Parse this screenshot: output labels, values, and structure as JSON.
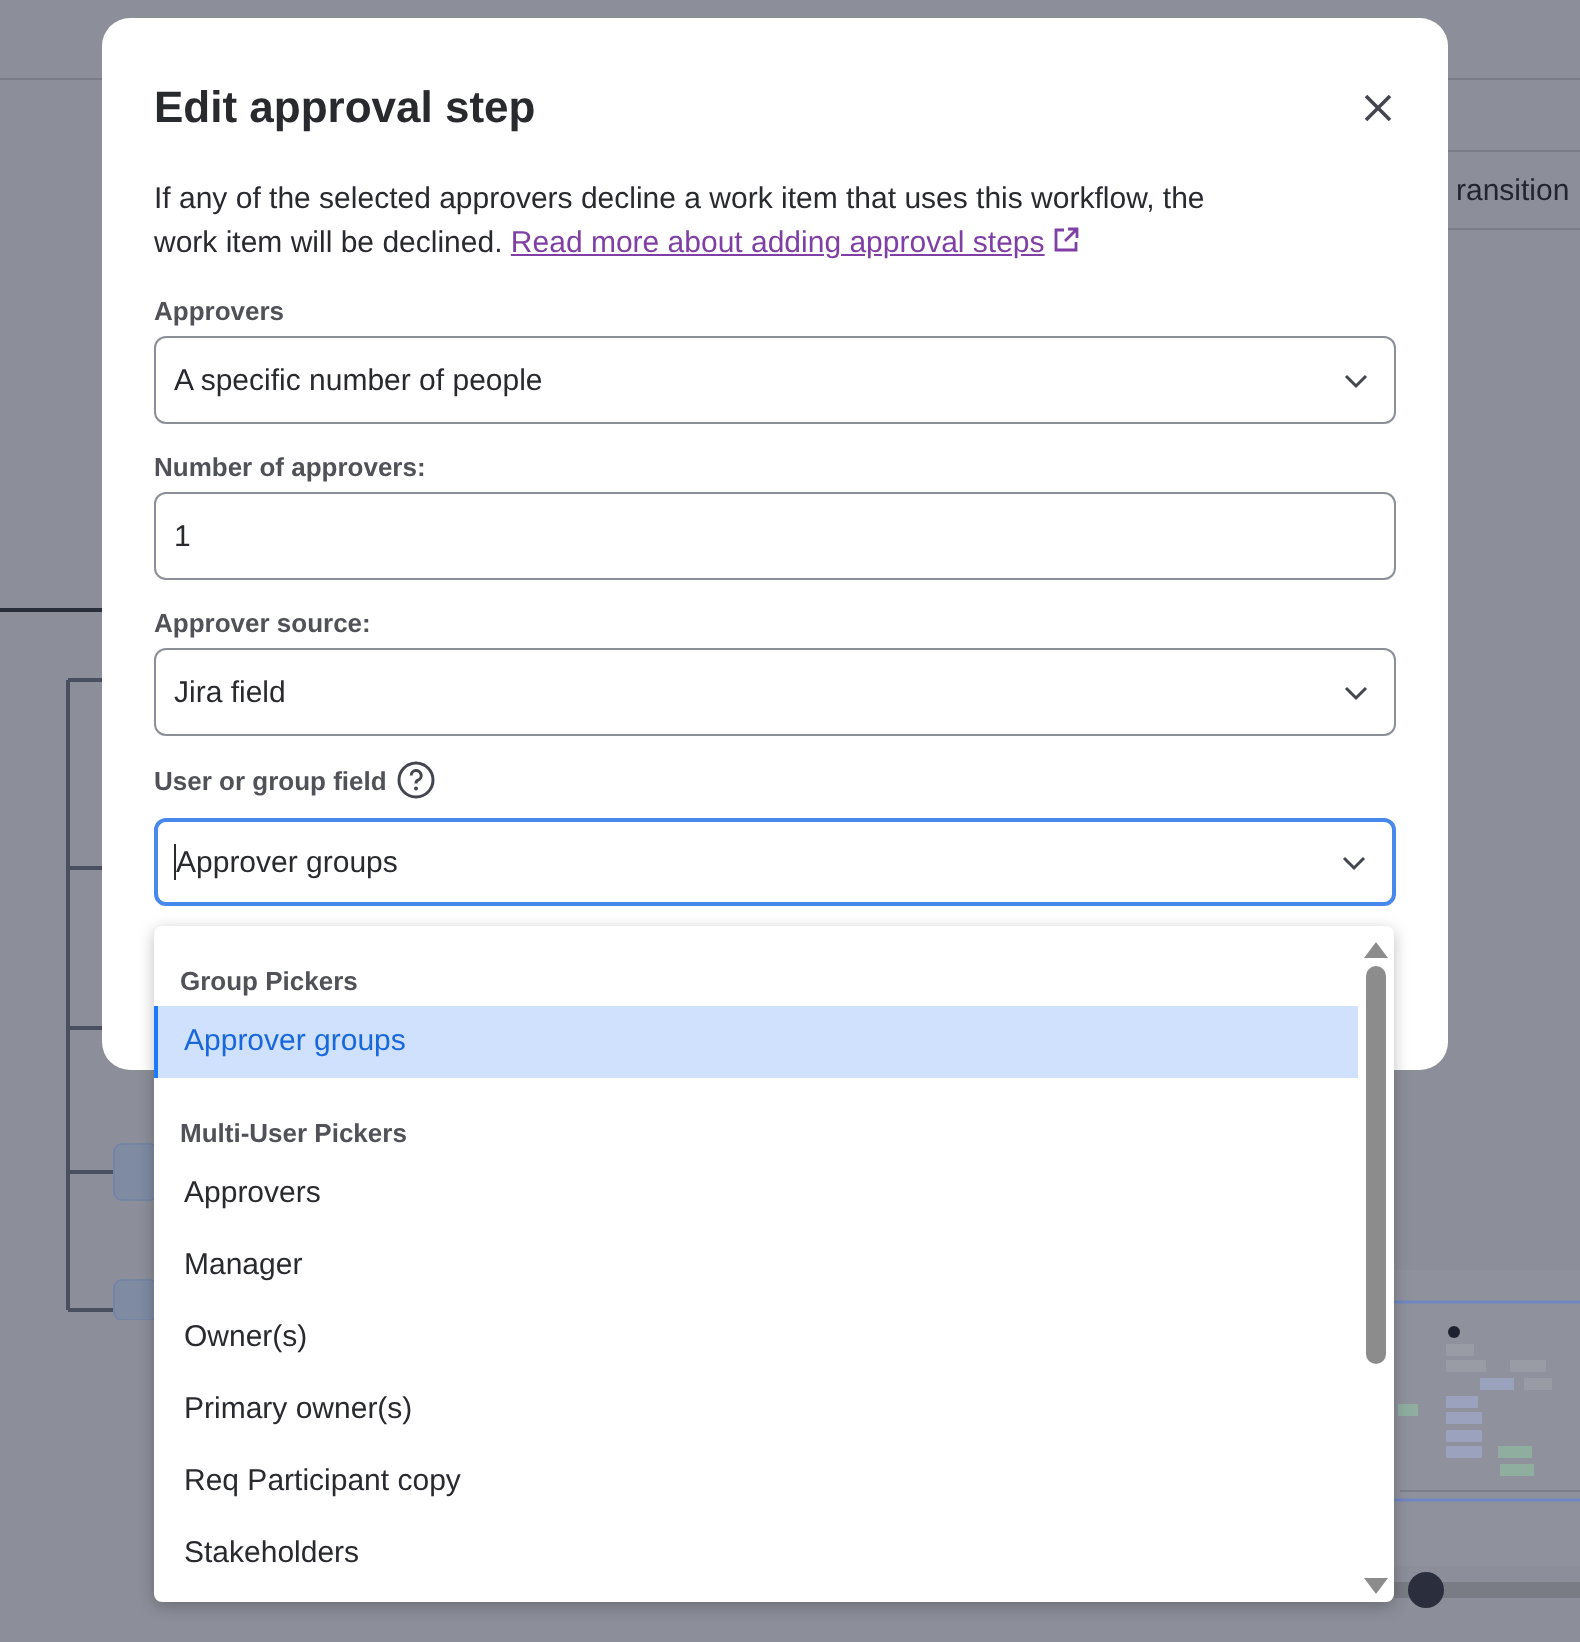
{
  "side_panel": {
    "tab": "ransition"
  },
  "dialog": {
    "title": "Edit approval step",
    "description": "If any of the selected approvers decline a work item that uses this workflow, the work item will be declined.",
    "link": "Read more about adding approval steps",
    "fields": [
      {
        "label": "Approvers",
        "kind": "select",
        "value": "A specific number of people",
        "help": false,
        "focused": false
      },
      {
        "label": "Number of approvers:",
        "kind": "text",
        "value": "1",
        "help": false,
        "focused": false
      },
      {
        "label": "Approver source:",
        "kind": "select",
        "value": "Jira field",
        "help": false,
        "focused": false
      },
      {
        "label": "User or group field",
        "kind": "select",
        "value": "Approver groups",
        "help": true,
        "focused": true
      }
    ]
  },
  "dropdown": {
    "groups": [
      {
        "heading": "Group Pickers",
        "options": [
          {
            "label": "Approver groups",
            "selected": true
          }
        ]
      },
      {
        "heading": "Multi-User Pickers",
        "options": [
          {
            "label": "Approvers",
            "selected": false
          },
          {
            "label": "Manager",
            "selected": false
          },
          {
            "label": "Owner(s)",
            "selected": false
          },
          {
            "label": "Primary owner(s)",
            "selected": false
          },
          {
            "label": "Req Participant copy",
            "selected": false
          },
          {
            "label": "Stakeholders",
            "selected": false
          }
        ]
      }
    ]
  }
}
